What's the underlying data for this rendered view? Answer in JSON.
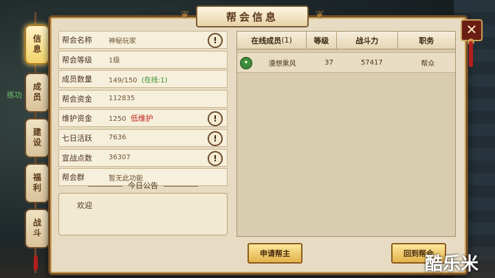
{
  "window": {
    "title": "帮会信息",
    "close": "✕"
  },
  "tabs": [
    {
      "label": "信息",
      "active": true
    },
    {
      "label": "成员",
      "active": false
    },
    {
      "label": "建设",
      "active": false
    },
    {
      "label": "福利",
      "active": false
    },
    {
      "label": "战斗",
      "active": false
    }
  ],
  "background": {
    "npc_label": "练功"
  },
  "info": {
    "rows": [
      {
        "key": "帮会名称",
        "value": "神秘玩家",
        "warn": true
      },
      {
        "key": "帮会等级",
        "value": "1级",
        "warn": false
      },
      {
        "key": "成员数量",
        "value": "149/150",
        "extra": "(在线:1)",
        "warn": false
      },
      {
        "key": "帮会资金",
        "value": "112835",
        "warn": false
      },
      {
        "key": "维护资金",
        "value": "1250",
        "extra": "低维护",
        "warn": true
      },
      {
        "key": "七日活跃",
        "value": "7636",
        "warn": true
      },
      {
        "key": "宣战点数",
        "value": "36307",
        "warn": true
      },
      {
        "key": "帮会群",
        "value": "暂无此功能",
        "warn": false
      }
    ],
    "warn_icon": "!"
  },
  "notice": {
    "title": "今日公告",
    "text": "欢迎"
  },
  "members": {
    "headers": {
      "online": "在线成员",
      "online_count": "(1)",
      "level": "等级",
      "power": "战斗力",
      "role": "职务"
    },
    "rows": [
      {
        "name": "漫想熏风",
        "level": "37",
        "power": "57417",
        "role": "帮众",
        "icon": "jade-icon"
      }
    ]
  },
  "buttons": {
    "apply_leader": "申请帮主",
    "return_guild": "回到帮会"
  },
  "watermark": "酷乐米",
  "colors": {
    "panel": "#e7dcc3",
    "border": "#6b4a2a",
    "green": "#2f8d2a",
    "red": "#c0221a",
    "button": "#e4b24a"
  }
}
